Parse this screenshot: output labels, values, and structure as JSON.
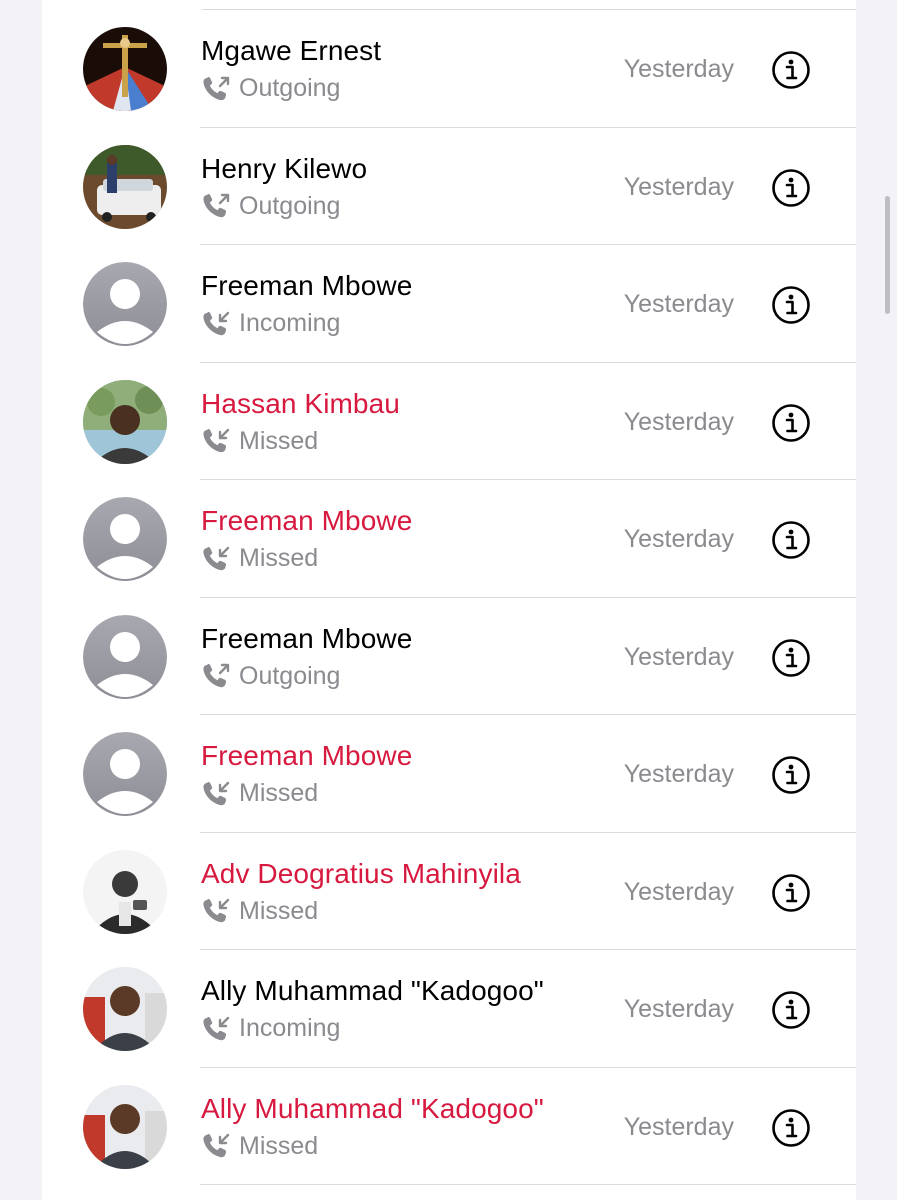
{
  "calls": [
    {
      "name": "Mgawe Ernest",
      "type": "Outgoing",
      "missed": false,
      "time": "Yesterday",
      "avatar": "photo-crucifix"
    },
    {
      "name": "Henry Kilewo",
      "type": "Outgoing",
      "missed": false,
      "time": "Yesterday",
      "avatar": "photo-car"
    },
    {
      "name": "Freeman Mbowe",
      "type": "Incoming",
      "missed": false,
      "time": "Yesterday",
      "avatar": "placeholder"
    },
    {
      "name": "Hassan Kimbau",
      "type": "Missed",
      "missed": true,
      "time": "Yesterday",
      "avatar": "photo-man-trees"
    },
    {
      "name": "Freeman Mbowe",
      "type": "Missed",
      "missed": true,
      "time": "Yesterday",
      "avatar": "placeholder"
    },
    {
      "name": "Freeman Mbowe",
      "type": "Outgoing",
      "missed": false,
      "time": "Yesterday",
      "avatar": "placeholder"
    },
    {
      "name": "Freeman Mbowe",
      "type": "Missed",
      "missed": true,
      "time": "Yesterday",
      "avatar": "placeholder"
    },
    {
      "name": "Adv Deogratius Mahinyila",
      "type": "Missed",
      "missed": true,
      "time": "Yesterday",
      "avatar": "photo-bw-man"
    },
    {
      "name": "Ally Muhammad \"Kadogoo\"",
      "type": "Incoming",
      "missed": false,
      "time": "Yesterday",
      "avatar": "photo-man-red"
    },
    {
      "name": "Ally Muhammad \"Kadogoo\"",
      "type": "Missed",
      "missed": true,
      "time": "Yesterday",
      "avatar": "photo-man-red"
    }
  ],
  "colors": {
    "missed": "#d7193f",
    "secondary": "#8a8a8f",
    "placeholder_bg": "#a2a2aa"
  },
  "icons": {
    "outgoing": "phone-outgoing-icon",
    "incoming": "phone-incoming-icon",
    "info": "info-circle-icon"
  }
}
